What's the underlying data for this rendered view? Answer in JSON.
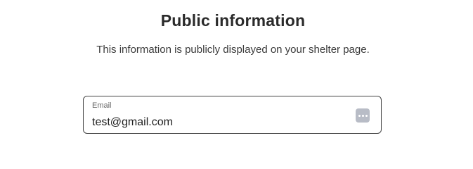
{
  "section": {
    "title": "Public information",
    "subtitle": "This information is publicly displayed on your shelter page."
  },
  "email_field": {
    "label": "Email",
    "value": "test@gmail.com",
    "autofill_icon": "password-manager-dots-icon"
  }
}
